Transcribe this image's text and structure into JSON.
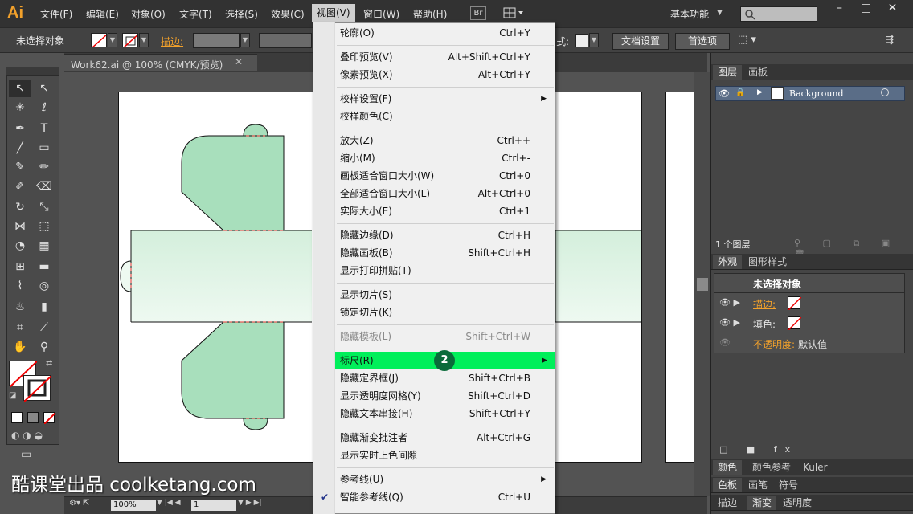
{
  "app": {
    "logo": "Ai",
    "workspace": "基本功能",
    "bridge": "Br"
  },
  "menubar": [
    "文件(F)",
    "编辑(E)",
    "对象(O)",
    "文字(T)",
    "选择(S)",
    "效果(C)",
    "视图(V)",
    "窗口(W)",
    "帮助(H)"
  ],
  "control": {
    "no_selection": "未选择对象",
    "stroke_label": "描边:",
    "style_label": "式:",
    "doc_setup": "文档设置",
    "preferences": "首选项"
  },
  "document": {
    "tab_title": "Work62.ai @ 100% (CMYK/预览)",
    "zoom": "100%",
    "page": "1"
  },
  "view_menu": {
    "groups": [
      [
        {
          "label": "轮廓(O)",
          "shortcut": "Ctrl+Y"
        }
      ],
      [
        {
          "label": "叠印预览(V)",
          "shortcut": "Alt+Shift+Ctrl+Y"
        },
        {
          "label": "像素预览(X)",
          "shortcut": "Alt+Ctrl+Y"
        }
      ],
      [
        {
          "label": "校样设置(F)",
          "shortcut": "",
          "submenu": true
        },
        {
          "label": "校样颜色(C)",
          "shortcut": ""
        }
      ],
      [
        {
          "label": "放大(Z)",
          "shortcut": "Ctrl++"
        },
        {
          "label": "缩小(M)",
          "shortcut": "Ctrl+-"
        },
        {
          "label": "画板适合窗口大小(W)",
          "shortcut": "Ctrl+0"
        },
        {
          "label": "全部适合窗口大小(L)",
          "shortcut": "Alt+Ctrl+0"
        },
        {
          "label": "实际大小(E)",
          "shortcut": "Ctrl+1"
        }
      ],
      [
        {
          "label": "隐藏边缘(D)",
          "shortcut": "Ctrl+H"
        },
        {
          "label": "隐藏画板(B)",
          "shortcut": "Shift+Ctrl+H"
        },
        {
          "label": "显示打印拼贴(T)",
          "shortcut": ""
        }
      ],
      [
        {
          "label": "显示切片(S)",
          "shortcut": ""
        },
        {
          "label": "锁定切片(K)",
          "shortcut": ""
        }
      ],
      [
        {
          "label": "隐藏模板(L)",
          "shortcut": "Shift+Ctrl+W",
          "disabled": true
        }
      ],
      [
        {
          "label": "标尺(R)",
          "shortcut": "",
          "submenu": true,
          "highlighted": true
        },
        {
          "label": "隐藏定界框(J)",
          "shortcut": "Shift+Ctrl+B"
        },
        {
          "label": "显示透明度网格(Y)",
          "shortcut": "Shift+Ctrl+D"
        },
        {
          "label": "隐藏文本串接(H)",
          "shortcut": "Shift+Ctrl+Y"
        }
      ],
      [
        {
          "label": "隐藏渐变批注者",
          "shortcut": "Alt+Ctrl+G"
        },
        {
          "label": "显示实时上色间隙",
          "shortcut": ""
        }
      ],
      [
        {
          "label": "参考线(U)",
          "shortcut": "",
          "submenu": true
        },
        {
          "label": "智能参考线(Q)",
          "shortcut": "Ctrl+U",
          "checked": true
        }
      ]
    ]
  },
  "step_badge": "2",
  "layers_panel": {
    "tabs": [
      "图层",
      "画板"
    ],
    "layer_name": "Background",
    "count": "1 个图层"
  },
  "appearance_panel": {
    "tabs": [
      "外观",
      "图形样式"
    ],
    "title": "未选择对象",
    "rows": [
      {
        "label": "描边:"
      },
      {
        "label": "填色:"
      },
      {
        "label": "不透明度:",
        "value": "默认值"
      }
    ]
  },
  "bottom_panels": [
    [
      "颜色",
      "颜色参考",
      "Kuler"
    ],
    [
      "色板",
      "画笔",
      "符号"
    ],
    [
      "描边",
      "渐变",
      "透明度"
    ]
  ],
  "watermark": "酷课堂出品 coolketang.com",
  "colors": {
    "accent_highlight": "#00ef5a",
    "orange": "#f2a12b",
    "shape_fill": "#9fdcb6"
  }
}
